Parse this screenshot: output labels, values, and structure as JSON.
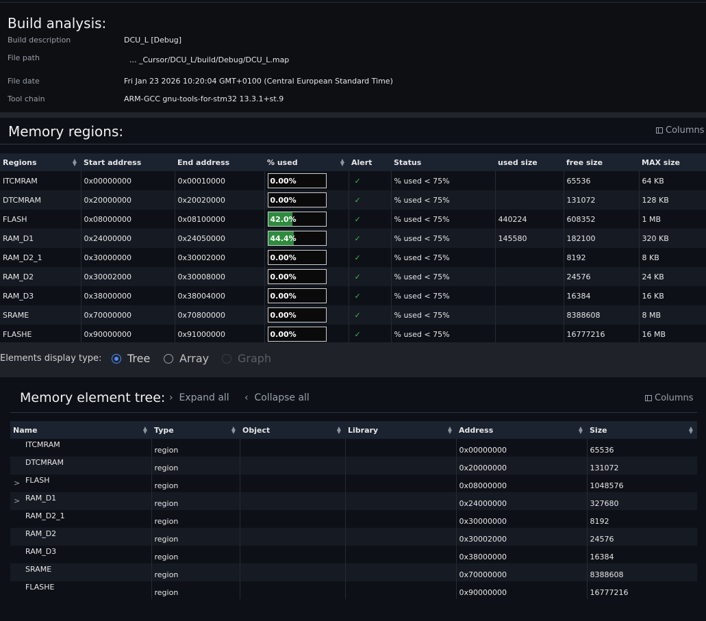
{
  "build": {
    "title": "Build analysis:",
    "rows": [
      {
        "label": "Build description",
        "value": "DCU_L [Debug]"
      },
      {
        "label": "File path",
        "value": "... _Cursor/DCU_L/build/Debug/DCU_L.map"
      },
      {
        "label": "File date",
        "value": "Fri Jan 23 2026 10:20:04 GMT+0100 (Central European Standard Time)"
      },
      {
        "label": "Tool chain",
        "value": "ARM-GCC gnu-tools-for-stm32 13.3.1+st.9"
      }
    ]
  },
  "regions": {
    "title": "Memory regions:",
    "columns_label": "Columns",
    "headers": [
      "Regions",
      "Start address",
      "End address",
      "% used",
      "Alert",
      "Status",
      "used size",
      "free size",
      "MAX size"
    ],
    "rows": [
      {
        "name": "ITCMRAM",
        "start": "0x00000000",
        "end": "0x00010000",
        "pct_label": "0.00%",
        "pct": 0,
        "status": "% used < 75%",
        "used": "",
        "free": "65536",
        "max": "64 KB"
      },
      {
        "name": "DTCMRAM",
        "start": "0x20000000",
        "end": "0x20020000",
        "pct_label": "0.00%",
        "pct": 0,
        "status": "% used < 75%",
        "used": "",
        "free": "131072",
        "max": "128 KB"
      },
      {
        "name": "FLASH",
        "start": "0x08000000",
        "end": "0x08100000",
        "pct_label": "42.0%",
        "pct": 42.0,
        "status": "% used < 75%",
        "used": "440224",
        "free": "608352",
        "max": "1 MB"
      },
      {
        "name": "RAM_D1",
        "start": "0x24000000",
        "end": "0x24050000",
        "pct_label": "44.4%",
        "pct": 44.4,
        "status": "% used < 75%",
        "used": "145580",
        "free": "182100",
        "max": "320 KB"
      },
      {
        "name": "RAM_D2_1",
        "start": "0x30000000",
        "end": "0x30002000",
        "pct_label": "0.00%",
        "pct": 0,
        "status": "% used < 75%",
        "used": "",
        "free": "8192",
        "max": "8 KB"
      },
      {
        "name": "RAM_D2",
        "start": "0x30002000",
        "end": "0x30008000",
        "pct_label": "0.00%",
        "pct": 0,
        "status": "% used < 75%",
        "used": "",
        "free": "24576",
        "max": "24 KB"
      },
      {
        "name": "RAM_D3",
        "start": "0x38000000",
        "end": "0x38004000",
        "pct_label": "0.00%",
        "pct": 0,
        "status": "% used < 75%",
        "used": "",
        "free": "16384",
        "max": "16 KB"
      },
      {
        "name": "SRAME",
        "start": "0x70000000",
        "end": "0x70800000",
        "pct_label": "0.00%",
        "pct": 0,
        "status": "% used < 75%",
        "used": "",
        "free": "8388608",
        "max": "8 MB"
      },
      {
        "name": "FLASHE",
        "start": "0x90000000",
        "end": "0x91000000",
        "pct_label": "0.00%",
        "pct": 0,
        "status": "% used < 75%",
        "used": "",
        "free": "16777216",
        "max": "16 MB"
      }
    ]
  },
  "display": {
    "label": "Elements display type:",
    "options": [
      "Tree",
      "Array",
      "Graph"
    ],
    "selected": "Tree"
  },
  "tree": {
    "title": "Memory element tree:",
    "expand_label": "Expand all",
    "collapse_label": "Collapse all",
    "columns_label": "Columns",
    "headers": [
      "Name",
      "Type",
      "Object",
      "Library",
      "Address",
      "Size"
    ],
    "rows": [
      {
        "name": "ITCMRAM",
        "expandable": false,
        "type": "region",
        "object": "",
        "library": "",
        "address": "0x00000000",
        "size": "65536"
      },
      {
        "name": "DTCMRAM",
        "expandable": false,
        "type": "region",
        "object": "",
        "library": "",
        "address": "0x20000000",
        "size": "131072"
      },
      {
        "name": "FLASH",
        "expandable": true,
        "type": "region",
        "object": "",
        "library": "",
        "address": "0x08000000",
        "size": "1048576"
      },
      {
        "name": "RAM_D1",
        "expandable": true,
        "type": "region",
        "object": "",
        "library": "",
        "address": "0x24000000",
        "size": "327680"
      },
      {
        "name": "RAM_D2_1",
        "expandable": false,
        "type": "region",
        "object": "",
        "library": "",
        "address": "0x30000000",
        "size": "8192"
      },
      {
        "name": "RAM_D2",
        "expandable": false,
        "type": "region",
        "object": "",
        "library": "",
        "address": "0x30002000",
        "size": "24576"
      },
      {
        "name": "RAM_D3",
        "expandable": false,
        "type": "region",
        "object": "",
        "library": "",
        "address": "0x38000000",
        "size": "16384"
      },
      {
        "name": "SRAME",
        "expandable": false,
        "type": "region",
        "object": "",
        "library": "",
        "address": "0x70000000",
        "size": "8388608"
      },
      {
        "name": "FLASHE",
        "expandable": false,
        "type": "region",
        "object": "",
        "library": "",
        "address": "0x90000000",
        "size": "16777216"
      }
    ]
  },
  "colors": {
    "accent": "#4c8dff",
    "bar_fill": "#2e8b3e",
    "check": "#3fb950"
  }
}
